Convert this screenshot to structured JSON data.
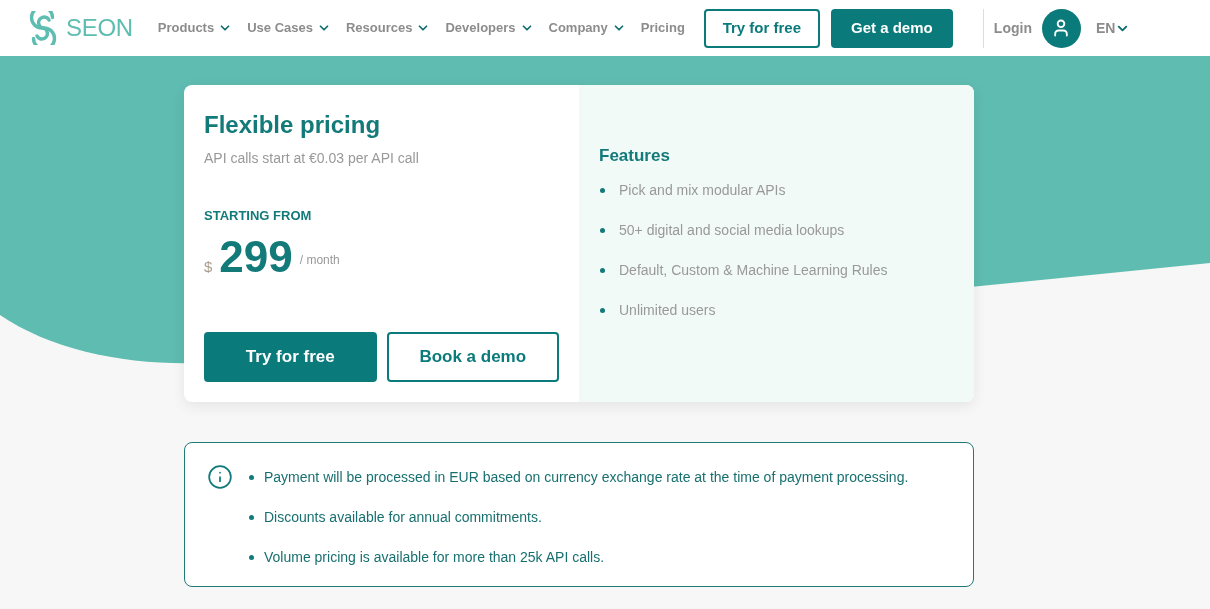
{
  "header": {
    "logo": {
      "text": "SEON"
    },
    "nav": [
      {
        "label": "Products",
        "dropdown": true
      },
      {
        "label": "Use Cases",
        "dropdown": true
      },
      {
        "label": "Resources",
        "dropdown": true
      },
      {
        "label": "Developers",
        "dropdown": true
      },
      {
        "label": "Company",
        "dropdown": true
      },
      {
        "label": "Pricing",
        "dropdown": false
      }
    ],
    "buttons": [
      {
        "label": "Try for free",
        "kind": "outline"
      },
      {
        "label": "Get a demo",
        "kind": "filled"
      }
    ],
    "login": "Login",
    "language": {
      "label": "EN",
      "dropdown": true
    }
  },
  "pricing_card": {
    "title": "Flexible pricing",
    "subtitle": "API calls start at €0.03 per API call",
    "starting_label": "STARTING FROM",
    "currency": "$",
    "price": "299",
    "period": "/ month",
    "buttons": [
      {
        "label": "Try for free",
        "kind": "filled"
      },
      {
        "label": "Book a demo",
        "kind": "outline"
      }
    ],
    "features": {
      "title": "Features",
      "items": [
        "Pick and mix modular APIs",
        "50+ digital and social media lookups",
        "Default, Custom & Machine Learning Rules",
        "Unlimited users"
      ]
    }
  },
  "notes": {
    "items": [
      "Payment will be processed in EUR based on currency exchange rate at the time of payment processing.",
      "Discounts available for annual commitments.",
      "Volume pricing is available for more than 25k API calls."
    ]
  }
}
